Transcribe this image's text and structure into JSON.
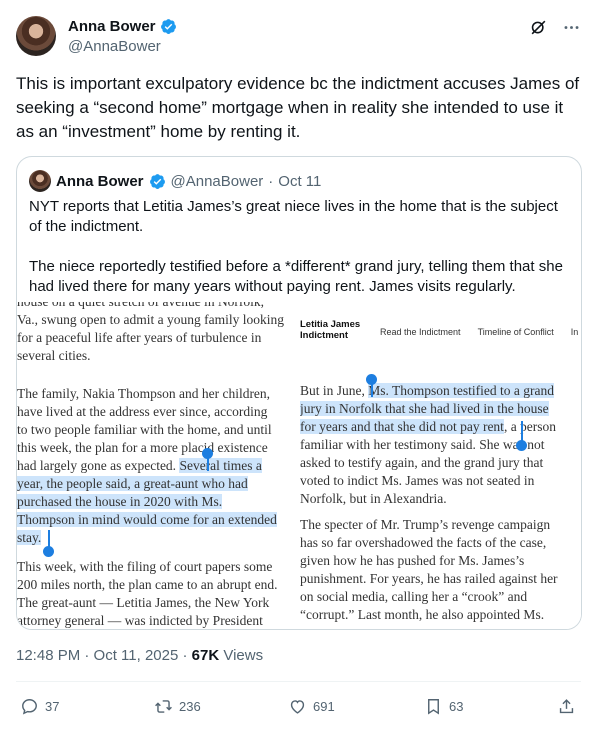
{
  "author": {
    "name": "Anna Bower",
    "handle": "@AnnaBower"
  },
  "tweet": {
    "text": "This is important exculpatory evidence bc the indictment accuses James of seeking a “second home” mortgage when in reality she intended to use it as an “investment” home by renting it."
  },
  "quote": {
    "name": "Anna Bower",
    "handle": "@AnnaBower",
    "separator": "·",
    "date": "Oct 11",
    "paragraphs": [
      "NYT reports that Letitia James’s great niece lives in the home that is the subject of the indictment.",
      "The niece reportedly testified before a *different* grand jury, telling them that she had lived there for many years without paying rent. James visits regularly."
    ]
  },
  "article": {
    "left_top_lines": [
      "house on a quiet stretch of avenue in Norfolk,",
      "Va., swung open to admit a young family looking",
      "for a peaceful life after years of turbulence in",
      "several cities."
    ],
    "left_mid_lines": [
      "The family, Nakia Thompson and her children,",
      "have lived at the address ever since, according",
      "to two people familiar with the home, and until",
      "this week, the plan for a more placid existence"
    ],
    "left_hl_pre": "had largely gone as expected.",
    "left_hl_lines": [
      "Several times a",
      "year, the people said, a great-aunt who had",
      "purchased the house in 2020 with Ms.",
      "Thompson in mind would come for an extended",
      "stay."
    ],
    "left_bottom_lines": [
      "This week, with the filing of court papers some",
      "200 miles north, the plan came to an abrupt end.",
      "The great-aunt — Letitia James, the New York",
      "attorney general — was indicted by President"
    ],
    "nyt_title_1": "Letitia James",
    "nyt_title_2": "Indictment",
    "nyt_nav": [
      "Read the Indictment",
      "Timeline of Conflict",
      "In"
    ],
    "right_p1_pre": "But in June,",
    "right_p1_hl": [
      "Ms. Thompson testified to a grand",
      "jury in Norfolk that she had lived in the house",
      "for years and that she did not pay rent"
    ],
    "right_p1_post_first": ", a person",
    "right_p1_lines": [
      "familiar with her testimony said. She was not",
      "asked to testify again, and the grand jury that",
      "voted to indict Ms. James was not seated in",
      "Norfolk, but in Alexandria."
    ],
    "right_p2_lines": [
      "The specter of Mr. Trump’s revenge campaign",
      "has so far overshadowed the facts of the case,",
      "given how he has pushed for Ms. James’s",
      "punishment. For years, he has railed against her",
      "on social media, calling her a “crook” and",
      "“corrupt.” Last month, he also appointed Ms."
    ]
  },
  "meta": {
    "time": "12:48 PM · Oct 11, 2025 · ",
    "views_count": "67K",
    "views_label": " Views"
  },
  "actions": {
    "replies": "37",
    "reposts": "236",
    "likes": "691",
    "bookmarks": "63"
  },
  "colors": {
    "verified": "#1d9bf0",
    "highlight": "#cde4fb",
    "selection_handle": "#1d7ee0",
    "muted": "#536471"
  }
}
